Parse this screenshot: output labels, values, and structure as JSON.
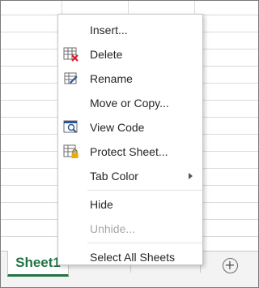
{
  "sheet_tabs": {
    "active_label": "Sheet1",
    "add_symbol": "+"
  },
  "context_menu": {
    "items": [
      {
        "label": "Insert...",
        "icon": "none"
      },
      {
        "label": "Delete",
        "icon": "delete-sheet-icon"
      },
      {
        "label": "Rename",
        "icon": "rename-sheet-icon"
      },
      {
        "label": "Move or Copy...",
        "icon": "none"
      },
      {
        "label": "View Code",
        "icon": "view-code-icon"
      },
      {
        "label": "Protect Sheet...",
        "icon": "protect-sheet-icon"
      },
      {
        "label": "Tab Color",
        "icon": "none",
        "submenu": true
      },
      {
        "label": "Hide",
        "icon": "none"
      },
      {
        "label": "Unhide...",
        "icon": "none",
        "disabled": true
      },
      {
        "label": "Select All Sheets",
        "icon": "none"
      }
    ]
  },
  "colors": {
    "accent": "#217346",
    "delete_x": "#e81123",
    "lock": "#f2a900"
  }
}
